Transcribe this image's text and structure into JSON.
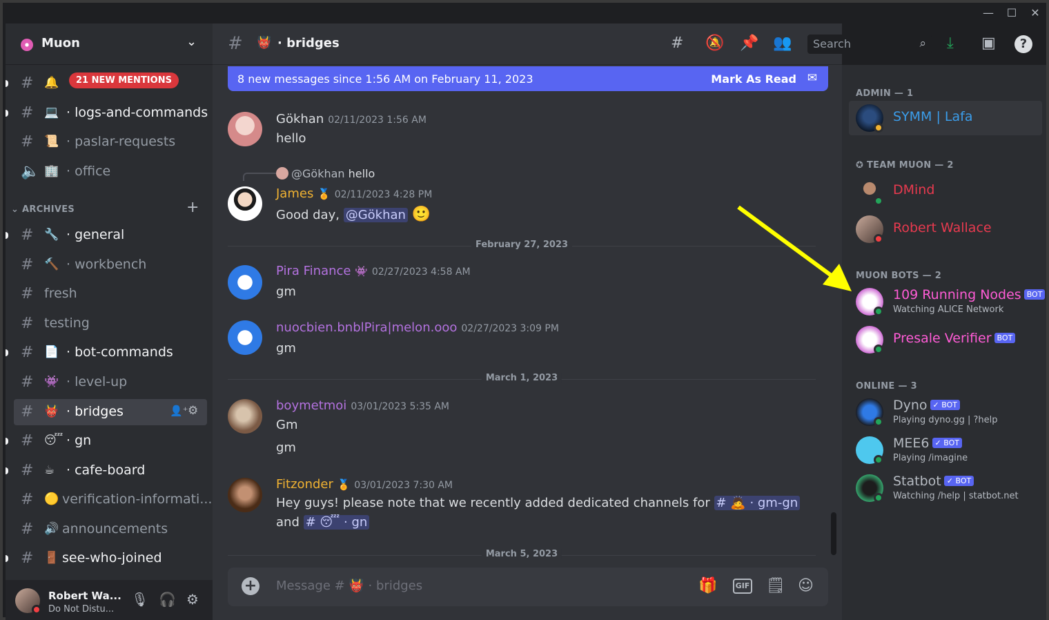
{
  "window": {
    "minimize": "—",
    "maximize": "☐",
    "close": "✕"
  },
  "server": {
    "name": "Muon"
  },
  "sidebar": {
    "mentions_pill": "21 NEW MENTIONS",
    "archives_label": "ARCHIVES",
    "channels": [
      {
        "emoji": "🔔",
        "name": ""
      },
      {
        "emoji": "💻",
        "name": "· logs-and-commands"
      },
      {
        "emoji": "📜",
        "name": "· paslar-requests"
      },
      {
        "emoji": "🏢",
        "name": "· office"
      },
      {
        "emoji": "🔧",
        "name": "· general"
      },
      {
        "emoji": "🔨",
        "name": "· workbench"
      },
      {
        "emoji": "",
        "name": "fresh"
      },
      {
        "emoji": "",
        "name": "testing"
      },
      {
        "emoji": "📄",
        "name": "· bot-commands"
      },
      {
        "emoji": "👾",
        "name": "· level-up"
      },
      {
        "emoji": "👹",
        "name": "· bridges"
      },
      {
        "emoji": "😴",
        "name": "· gn"
      },
      {
        "emoji": "☕",
        "name": "· cafe-board"
      },
      {
        "emoji": "🟡",
        "name": "verification-informati..."
      },
      {
        "emoji": "🔊",
        "name": "announcements"
      },
      {
        "emoji": "🚪",
        "name": "see-who-joined"
      }
    ]
  },
  "user_panel": {
    "name": "Robert Wa...",
    "status": "Do Not Distu..."
  },
  "header": {
    "channel_emoji": "👹",
    "channel_name": "· bridges",
    "search_placeholder": "Search"
  },
  "banner": {
    "text": "8 new messages since 1:56 AM on February 11, 2023",
    "action": "Mark As Read"
  },
  "messages": {
    "m1": {
      "author": "Gökhan",
      "time": "02/11/2023 1:56 AM",
      "text": "hello"
    },
    "reply": {
      "mention": "@Gökhan",
      "text": "hello"
    },
    "m2": {
      "author": "James",
      "time": "02/11/2023 4:28 PM",
      "text": "Good day,",
      "mention": "@Gökhan",
      "emoji": "🙂"
    },
    "d1": "February 27, 2023",
    "m3": {
      "author": "Pira Finance",
      "time": "02/27/2023 4:58 AM",
      "text": "gm"
    },
    "m4": {
      "author": "nuocbien.bnblPira|melon.ooo",
      "time": "02/27/2023 3:09 PM",
      "text": "gm"
    },
    "d2": "March 1, 2023",
    "m5": {
      "author": "boymetmoi",
      "time": "03/01/2023 5:35 AM",
      "text1": "Gm",
      "text2": "gm"
    },
    "m6": {
      "author": "Fitzonder",
      "time": "03/01/2023 7:30 AM",
      "text1": "Hey guys! please note that we recently added dedicated channels for",
      "ch1": "# 🙇 · gm-gn",
      "text2": "and",
      "ch2": "# 😴 · gn"
    },
    "d3": "March 5, 2023"
  },
  "composer": {
    "placeholder": "Message # 👹 · bridges",
    "gif": "GIF"
  },
  "members": {
    "admin_header": "ADMIN — 1",
    "team_header": "✪ TEAM MUON — 2",
    "bots_header": "MUON BOTS — 2",
    "online_header": "ONLINE — 3",
    "bot_tag": "BOT",
    "bot_tag_verified": "✓ BOT",
    "list": [
      {
        "name": "SYMM | Lafa",
        "color": "#3b9dea"
      },
      {
        "name": "DMind",
        "color": "#e83a4f"
      },
      {
        "name": "Robert Wallace",
        "color": "#e83a4f"
      },
      {
        "name": "109 Running Nodes",
        "sub": "Watching ALICE Network",
        "color": "#ff5cd6"
      },
      {
        "name": "Presale Verifier",
        "color": "#ff5cd6"
      },
      {
        "name": "Dyno",
        "sub": "Playing dyno.gg | ?help",
        "color": "#b5bac1"
      },
      {
        "name": "MEE6",
        "sub": "Playing /imagine",
        "color": "#b5bac1"
      },
      {
        "name": "Statbot",
        "sub": "Watching /help | statbot.net",
        "color": "#b5bac1"
      }
    ]
  },
  "colors": {
    "accent": "#5865f2",
    "annotation_arrow": "#ffff00"
  }
}
